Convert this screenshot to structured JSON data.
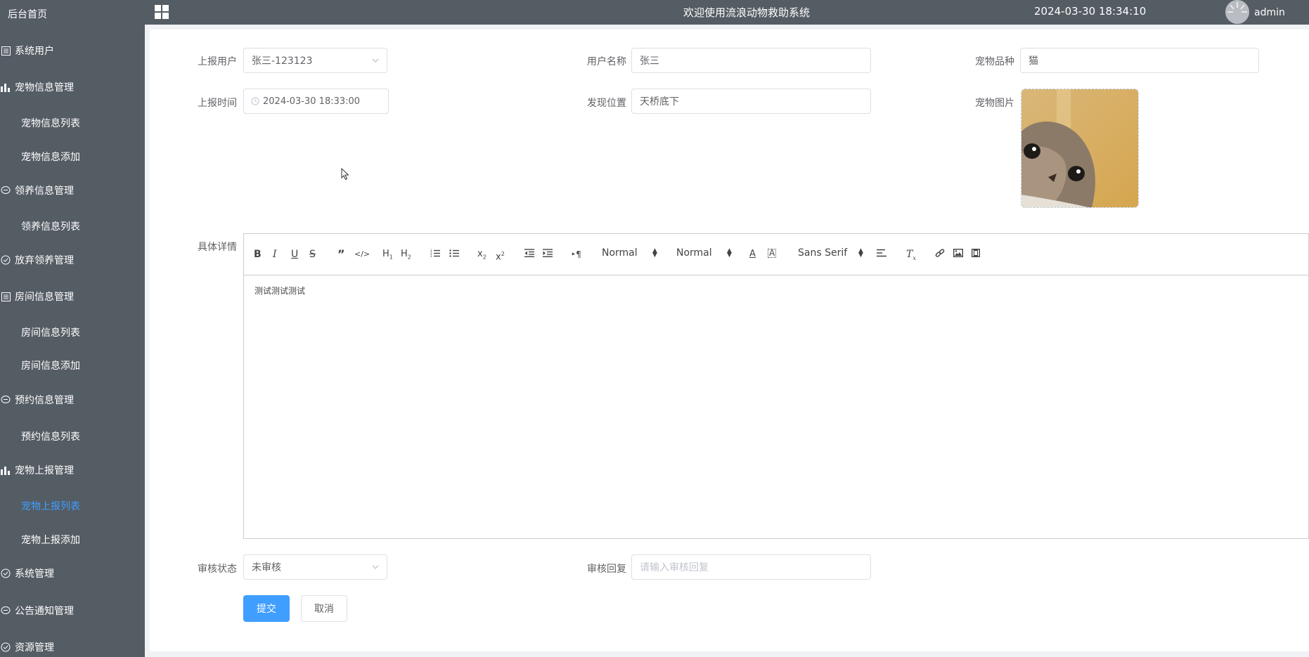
{
  "header": {
    "title": "欢迎使用流浪动物救助系统",
    "datetime": "2024-03-30 18:34:10",
    "username": "admin"
  },
  "sidebar": {
    "home": "后台首页",
    "groups": [
      {
        "label": "系统用户",
        "icon": "list-icon",
        "items": []
      },
      {
        "label": "宠物信息管理",
        "icon": "bar-chart-icon",
        "items": [
          "宠物信息列表",
          "宠物信息添加"
        ]
      },
      {
        "label": "领养信息管理",
        "icon": "chat-icon",
        "items": [
          "领养信息列表"
        ]
      },
      {
        "label": "放弃领养管理",
        "icon": "check-circle-icon",
        "items": []
      },
      {
        "label": "房间信息管理",
        "icon": "list-icon",
        "items": [
          "房间信息列表",
          "房间信息添加"
        ]
      },
      {
        "label": "预约信息管理",
        "icon": "chat-icon",
        "items": [
          "预约信息列表"
        ]
      },
      {
        "label": "宠物上报管理",
        "icon": "bar-chart-icon",
        "items": [
          "宠物上报列表",
          "宠物上报添加"
        ]
      },
      {
        "label": "系统管理",
        "icon": "check-circle-icon",
        "items": []
      },
      {
        "label": "公告通知管理",
        "icon": "chat-icon",
        "items": []
      },
      {
        "label": "资源管理",
        "icon": "check-circle-icon",
        "items": []
      }
    ],
    "active_item": "宠物上报列表"
  },
  "form": {
    "report_user": {
      "label": "上报用户",
      "value": "张三-123123"
    },
    "user_name": {
      "label": "用户名称",
      "value": "张三"
    },
    "pet_breed": {
      "label": "宠物品种",
      "value": "猫"
    },
    "report_time": {
      "label": "上报时间",
      "value": "2024-03-30 18:33:00"
    },
    "location": {
      "label": "发现位置",
      "value": "天桥底下"
    },
    "pet_image": {
      "label": "宠物图片"
    },
    "details": {
      "label": "具体详情",
      "content": "测试测试测试"
    },
    "review_status": {
      "label": "审核状态",
      "value": "未审核"
    },
    "review_reply": {
      "label": "审核回复",
      "placeholder": "请输入审核回复"
    },
    "submit_label": "提交",
    "cancel_label": "取消"
  },
  "editor_toolbar": {
    "header_select": "Normal",
    "size_select": "Normal",
    "font_select": "Sans Serif"
  },
  "colors": {
    "sidebar_bg": "#545c64",
    "accent": "#409eff"
  }
}
